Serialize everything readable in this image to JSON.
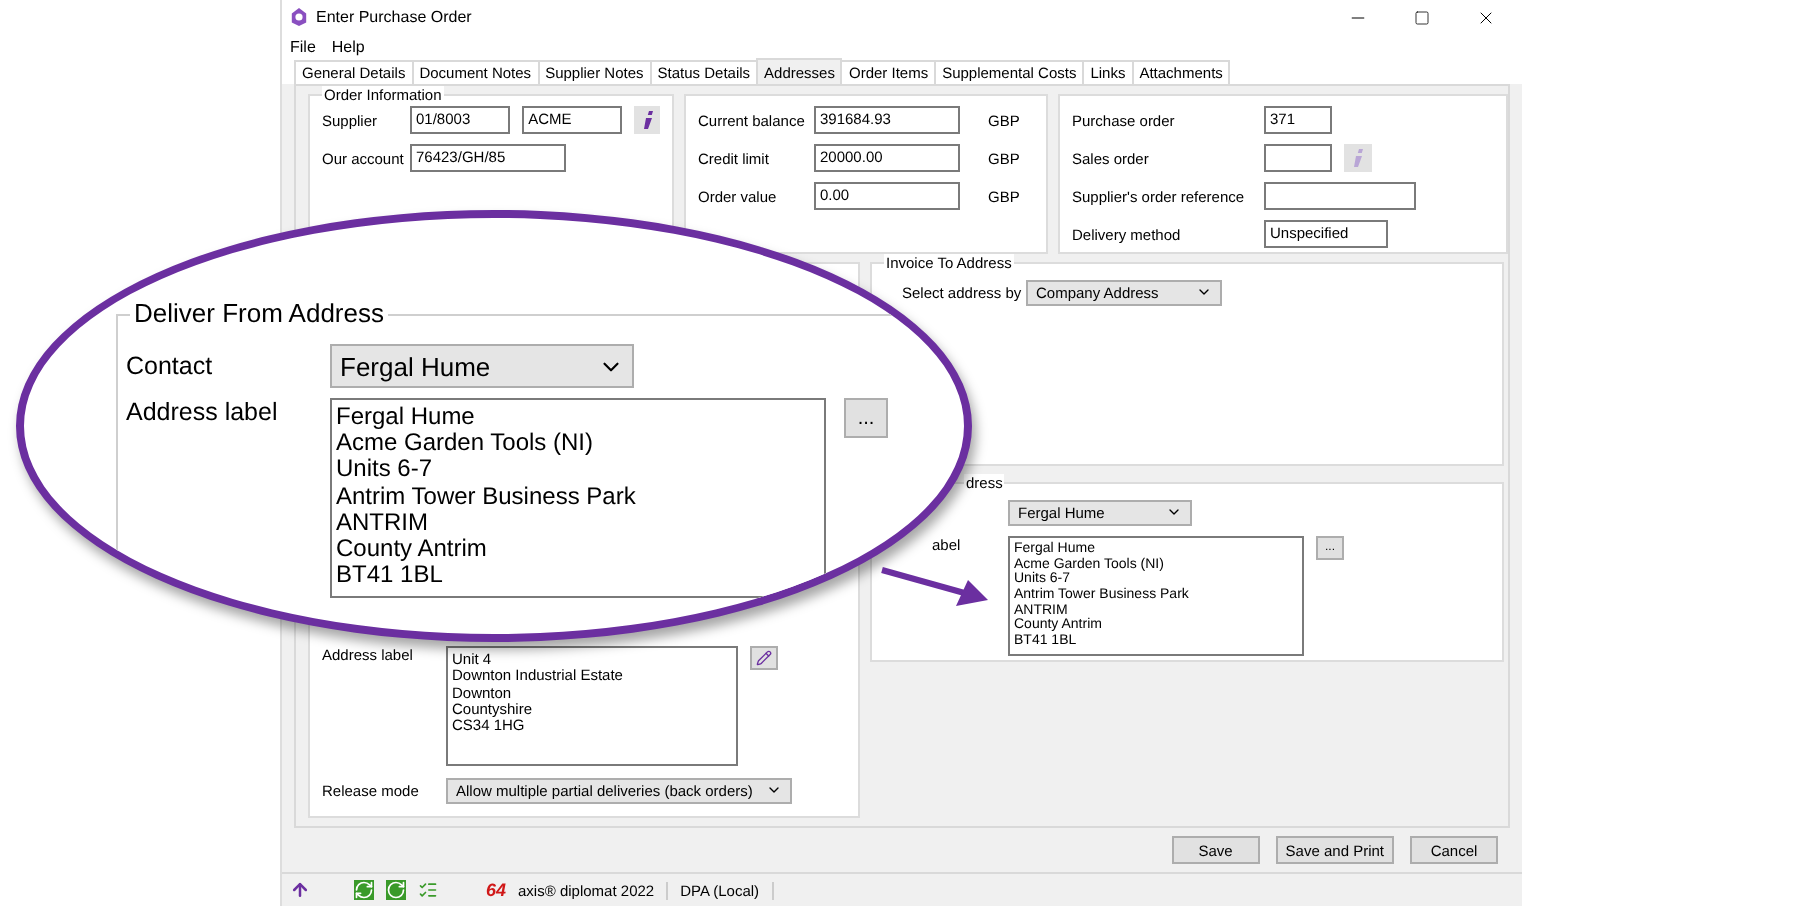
{
  "window": {
    "title": "Enter Purchase Order"
  },
  "menu": [
    "File",
    "Help"
  ],
  "tabs": [
    {
      "label": "General Details",
      "selected": false
    },
    {
      "label": "Document Notes",
      "selected": false
    },
    {
      "label": "Supplier Notes",
      "selected": false
    },
    {
      "label": "Status Details",
      "selected": false
    },
    {
      "label": "Addresses",
      "selected": true
    },
    {
      "label": "Order Items",
      "selected": false
    },
    {
      "label": "Supplemental Costs",
      "selected": false
    },
    {
      "label": "Links",
      "selected": false
    },
    {
      "label": "Attachments",
      "selected": false
    }
  ],
  "order_information": {
    "title": "Order Information",
    "supplier_label": "Supplier",
    "supplier_code": "01/8003",
    "supplier_name": "ACME",
    "supplier_info_disabled": false,
    "account_label": "Our account",
    "account": "76423/GH/85"
  },
  "balances": [
    {
      "label": "Current balance",
      "value": "391684.93",
      "currency": "GBP"
    },
    {
      "label": "Credit limit",
      "value": "20000.00",
      "currency": "GBP"
    },
    {
      "label": "Order value",
      "value": "0.00",
      "currency": "GBP"
    }
  ],
  "order_refs": [
    {
      "label": "Purchase order",
      "value": "371",
      "kind": "short"
    },
    {
      "label": "Sales order",
      "kind": "info",
      "info_disabled": true
    },
    {
      "label": "Supplier's order reference",
      "kind": "wide"
    },
    {
      "label": "Delivery method",
      "value": "Unspecified",
      "kind": "medium"
    }
  ],
  "invoice_address": {
    "title": "Invoice To Address",
    "select_label": "Select address by",
    "select_value": "Company Address"
  },
  "delivery_address": {
    "title": "dress",
    "contact": "Fergal Hume",
    "label": "abel",
    "lines": [
      "Fergal Hume",
      "Acme Garden Tools (NI)",
      "Units 6-7",
      "Antrim Tower Business Park",
      "ANTRIM",
      "County Antrim",
      "BT41 1BL"
    ],
    "more": "..."
  },
  "deliver_from": {
    "address_label": "Address label",
    "lines": [
      "Unit 4",
      "Downton Industrial Estate",
      "Downton",
      "Countyshire",
      "CS34 1HG"
    ],
    "release_label": "Release mode",
    "release_value": "Allow multiple partial deliveries (back orders)"
  },
  "callout": {
    "title": "Deliver From Address",
    "contact_label": "Contact",
    "contact_value": "Fergal Hume",
    "address_label": "Address label",
    "lines": [
      "Fergal Hume",
      "Acme Garden Tools (NI)",
      "Units 6-7",
      "Antrim Tower Business Park",
      "ANTRIM",
      "County Antrim",
      "BT41 1BL"
    ],
    "more": "..."
  },
  "buttons": [
    "Save",
    "Save and Print",
    "Cancel"
  ],
  "status_bar": {
    "logo": "64",
    "product": "axis® diplomat 2022",
    "source": "DPA (Local)"
  }
}
